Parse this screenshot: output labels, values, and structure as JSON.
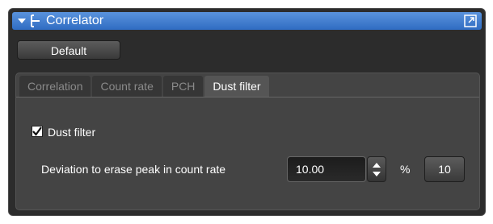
{
  "window": {
    "title": "Correlator"
  },
  "toolbar": {
    "default_label": "Default"
  },
  "tabs": [
    {
      "label": "Correlation",
      "active": false
    },
    {
      "label": "Count rate",
      "active": false
    },
    {
      "label": "PCH",
      "active": false
    },
    {
      "label": "Dust filter",
      "active": true
    }
  ],
  "dust_filter": {
    "checkbox_label": "Dust filter",
    "checked": true,
    "deviation_label": "Deviation to erase peak in count rate",
    "deviation_value": "10.00",
    "unit": "%",
    "preset_label": "10"
  },
  "icons": {
    "collapse": "triangle-down-icon",
    "tree": "tree-icon",
    "popout": "popout-icon",
    "check": "checkmark-icon",
    "stepper": "stepper-arrows-icon"
  },
  "colors": {
    "title_bar": "#3b78cf",
    "panel": "#2c2c2c",
    "tab_content": "#444444"
  }
}
